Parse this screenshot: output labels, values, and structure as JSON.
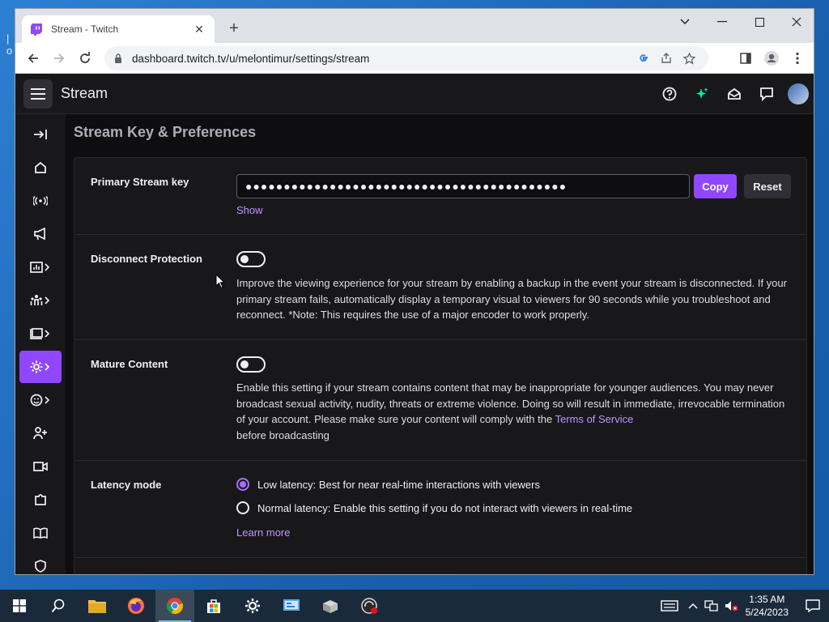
{
  "browser": {
    "tab_title": "Stream - Twitch",
    "url": "dashboard.twitch.tv/u/melontimur/settings/stream"
  },
  "app": {
    "page_title": "Stream",
    "section_title": "Stream Key & Preferences",
    "accent_color": "#9147ff"
  },
  "stream_key": {
    "label": "Primary Stream key",
    "value": "●●●●●●●●●●●●●●●●●●●●●●●●●●●●●●●●●●●●●●●●●●",
    "copy_label": "Copy",
    "reset_label": "Reset",
    "show_label": "Show"
  },
  "disconnect": {
    "label": "Disconnect Protection",
    "enabled": false,
    "description": "Improve the viewing experience for your stream by enabling a backup in the event your stream is disconnected. If your primary stream fails, automatically display a temporary visual to viewers for 90 seconds while you troubleshoot and reconnect. *Note: This requires the use of a major encoder to work properly."
  },
  "mature": {
    "label": "Mature Content",
    "enabled": false,
    "description": "Enable this setting if your stream contains content that may be inappropriate for younger audiences. You may never broadcast sexual activity, nudity, threats or extreme violence. Doing so will result in immediate, irrevocable termination of your account. Please make sure your content will comply with the ",
    "tos_link": "Terms of Service",
    "description_end": "before broadcasting"
  },
  "latency": {
    "label": "Latency mode",
    "options": [
      {
        "label": "Low latency: Best for near real-time interactions with viewers",
        "selected": true
      },
      {
        "label": "Normal latency: Enable this setting if you do not interact with viewers in real-time",
        "selected": false
      }
    ],
    "learn_more": "Learn more"
  },
  "taskbar": {
    "time": "1:35 AM",
    "date": "5/24/2023"
  }
}
